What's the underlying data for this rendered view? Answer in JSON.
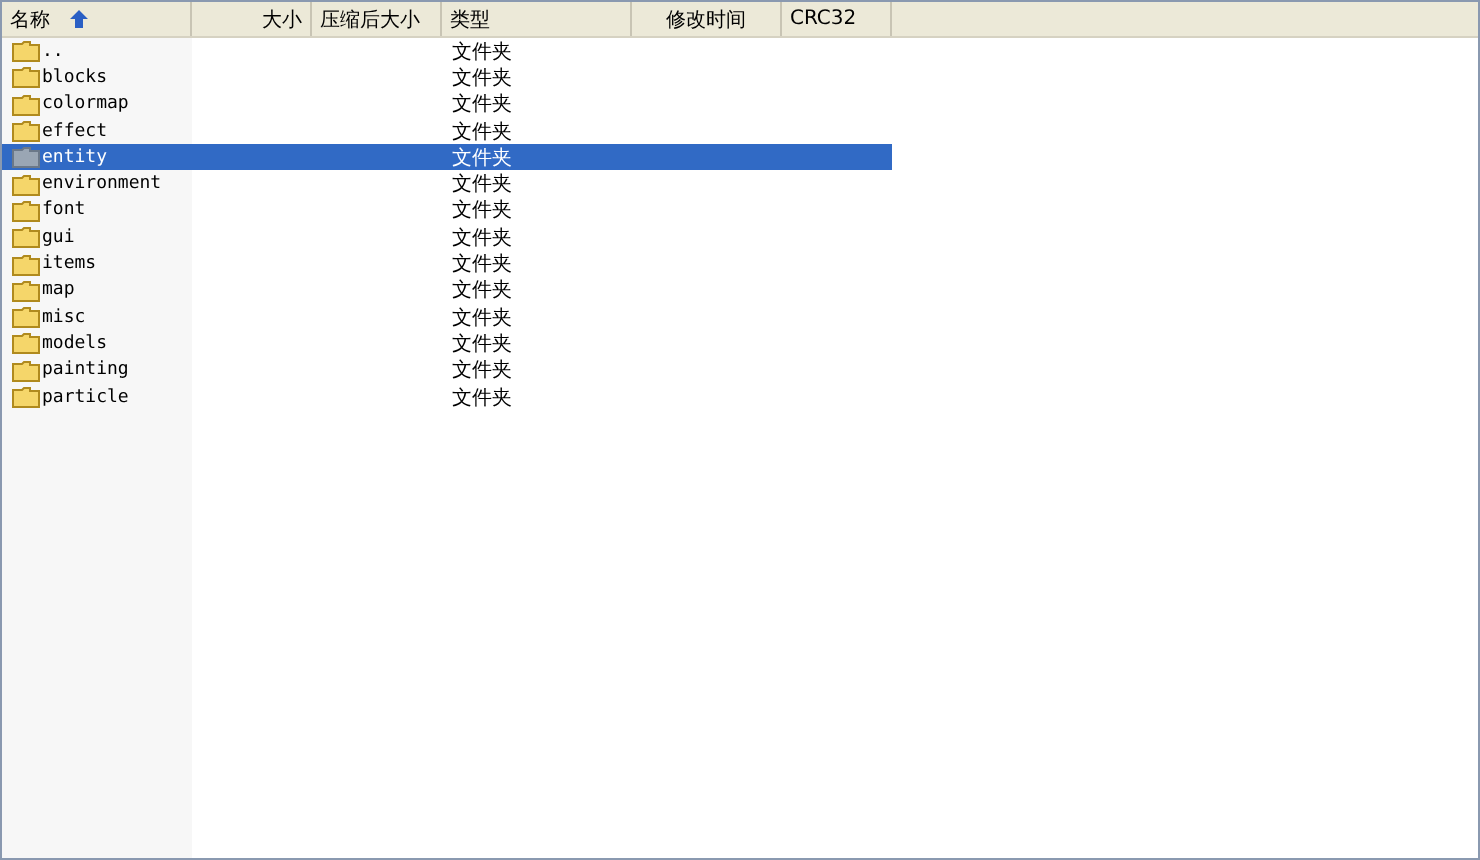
{
  "columns": [
    {
      "label": "名称",
      "sorted": true
    },
    {
      "label": "大小",
      "sorted": false
    },
    {
      "label": "压缩后大小",
      "sorted": false
    },
    {
      "label": "类型",
      "sorted": false
    },
    {
      "label": "修改时间",
      "sorted": false
    },
    {
      "label": "CRC32",
      "sorted": false
    }
  ],
  "rows": [
    {
      "name": "..",
      "type": "文件夹",
      "selected": false
    },
    {
      "name": "blocks",
      "type": "文件夹",
      "selected": false
    },
    {
      "name": "colormap",
      "type": "文件夹",
      "selected": false
    },
    {
      "name": "effect",
      "type": "文件夹",
      "selected": false
    },
    {
      "name": "entity",
      "type": "文件夹",
      "selected": true
    },
    {
      "name": "environment",
      "type": "文件夹",
      "selected": false
    },
    {
      "name": "font",
      "type": "文件夹",
      "selected": false
    },
    {
      "name": "gui",
      "type": "文件夹",
      "selected": false
    },
    {
      "name": "items",
      "type": "文件夹",
      "selected": false
    },
    {
      "name": "map",
      "type": "文件夹",
      "selected": false
    },
    {
      "name": "misc",
      "type": "文件夹",
      "selected": false
    },
    {
      "name": "models",
      "type": "文件夹",
      "selected": false
    },
    {
      "name": "painting",
      "type": "文件夹",
      "selected": false
    },
    {
      "name": "particle",
      "type": "文件夹",
      "selected": false
    }
  ]
}
